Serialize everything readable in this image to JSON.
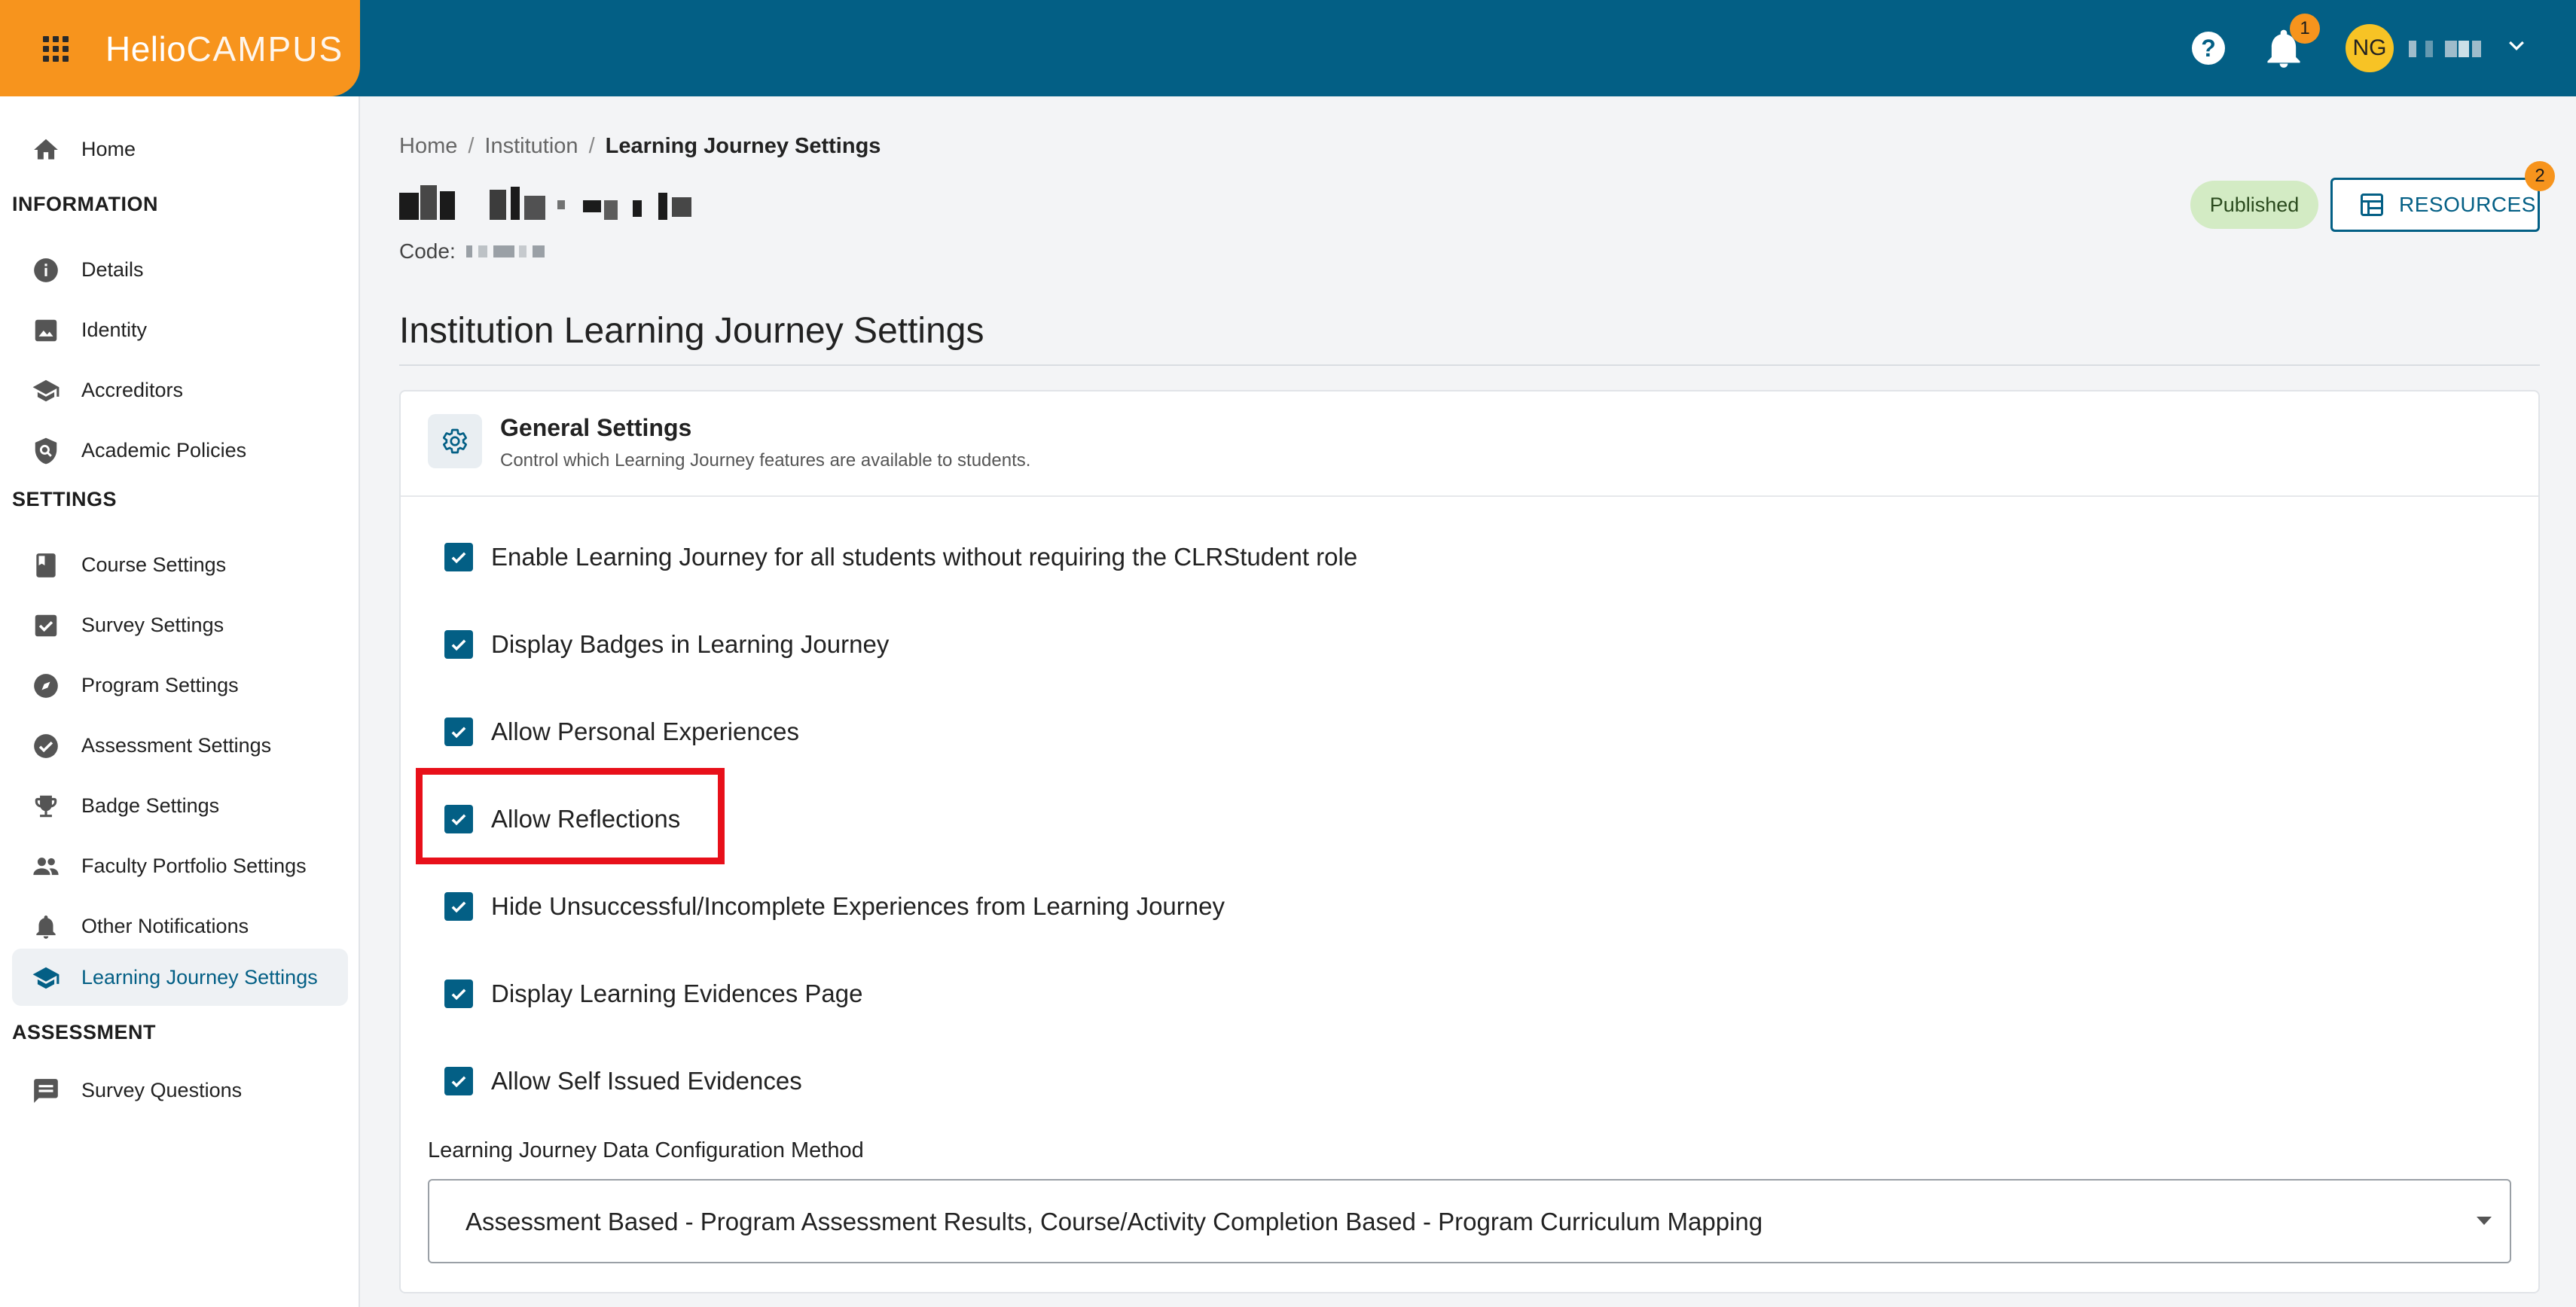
{
  "header": {
    "logo_part1": "Helio",
    "logo_part2": "CAMPUS",
    "help_icon": "?",
    "notification_count": "1",
    "user_initials": "NG"
  },
  "sidebar": {
    "items": [
      {
        "label": "Home",
        "icon": "home-icon"
      },
      {
        "label": "Details",
        "icon": "info-icon"
      },
      {
        "label": "Identity",
        "icon": "image-icon"
      },
      {
        "label": "Accreditors",
        "icon": "school-icon"
      },
      {
        "label": "Academic Policies",
        "icon": "policy-icon"
      },
      {
        "label": "Course Settings",
        "icon": "book-icon"
      },
      {
        "label": "Survey Settings",
        "icon": "checkbox-icon"
      },
      {
        "label": "Program Settings",
        "icon": "compass-icon"
      },
      {
        "label": "Assessment Settings",
        "icon": "check-circle-icon"
      },
      {
        "label": "Badge Settings",
        "icon": "trophy-icon"
      },
      {
        "label": "Faculty Portfolio Settings",
        "icon": "people-icon"
      },
      {
        "label": "Other Notifications",
        "icon": "bell-icon"
      },
      {
        "label": "Learning Journey Settings",
        "icon": "school-icon"
      },
      {
        "label": "Survey Questions",
        "icon": "comment-icon"
      }
    ],
    "sections": [
      "INFORMATION",
      "SETTINGS",
      "ASSESSMENT"
    ],
    "active": "Learning Journey Settings"
  },
  "breadcrumb": [
    "Home",
    "Institution",
    "Learning Journey Settings"
  ],
  "code_label": "Code:",
  "status_badge": "Published",
  "resources": {
    "label": "RESOURCES",
    "badge": "2"
  },
  "page_title": "Institution Learning Journey Settings",
  "general_settings": {
    "title": "General Settings",
    "subtitle": "Control which Learning Journey features are available to students.",
    "options": [
      {
        "label": "Enable Learning Journey for all students without requiring the CLRStudent role",
        "checked": true
      },
      {
        "label": "Display Badges in Learning Journey",
        "checked": true
      },
      {
        "label": "Allow Personal Experiences",
        "checked": true
      },
      {
        "label": "Allow Reflections",
        "checked": true
      },
      {
        "label": "Hide Unsuccessful/Incomplete Experiences from Learning Journey",
        "checked": true
      },
      {
        "label": "Display Learning Evidences Page",
        "checked": true
      },
      {
        "label": "Allow Self Issued Evidences",
        "checked": true
      }
    ]
  },
  "data_config": {
    "label": "Learning Journey Data Configuration Method",
    "value": "Assessment Based - Program Assessment Results, Course/Activity Completion Based - Program Curriculum Mapping"
  },
  "colors": {
    "topbar": "#035f85",
    "brand": "#f7941d",
    "accent": "#035f85",
    "published_bg": "#d3ebc4",
    "highlight": "#e8101a"
  }
}
